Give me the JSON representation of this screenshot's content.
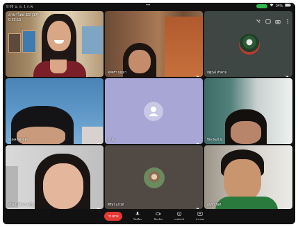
{
  "status_bar": {
    "time": "9:09 น. อ. 1 ก.พ.",
    "battery": "94%"
  },
  "meeting": {
    "title": "ภาษาไทย 3/2 (17)",
    "elapsed": "0:22:15"
  },
  "participants": [
    {
      "id": "p1",
      "name": "",
      "mic_muted": false,
      "avatar_type": "video"
    },
    {
      "id": "p2",
      "name": "สุพัตรา บุญมา",
      "mic_muted": true,
      "avatar_type": "video"
    },
    {
      "id": "p3",
      "name": "ณัฐวุฒิ ทำคาม",
      "mic_muted": true,
      "avatar_type": "photo"
    },
    {
      "id": "p4",
      "name": "ธนพล ทองแดง",
      "mic_muted": true,
      "avatar_type": "video"
    },
    {
      "id": "p5",
      "name": "ภาณุ",
      "mic_muted": true,
      "avatar_type": "placeholder"
    },
    {
      "id": "p6",
      "name": "ปิยะวัฒน์ ธ.",
      "mic_muted": true,
      "avatar_type": "video"
    },
    {
      "id": "p7",
      "name": "สุนิสา เลิศประเสริฐ",
      "mic_muted": true,
      "avatar_type": "video"
    },
    {
      "id": "p8",
      "name": "ศิริพร แก้วดี",
      "mic_muted": true,
      "avatar_type": "photo"
    },
    {
      "id": "p9",
      "name": "อนุชา ใจดี",
      "mic_muted": true,
      "avatar_type": "video"
    }
  ],
  "controls": {
    "end_label": "วางสาย",
    "mic_label": "ปิดเสียง",
    "camera_label": "ปิดกล้อง",
    "effects_label": "เอฟเฟกต์",
    "present_label": "นำเสนอ"
  },
  "colors": {
    "end_call": "#e53935",
    "mic_active": "#2db84d"
  }
}
